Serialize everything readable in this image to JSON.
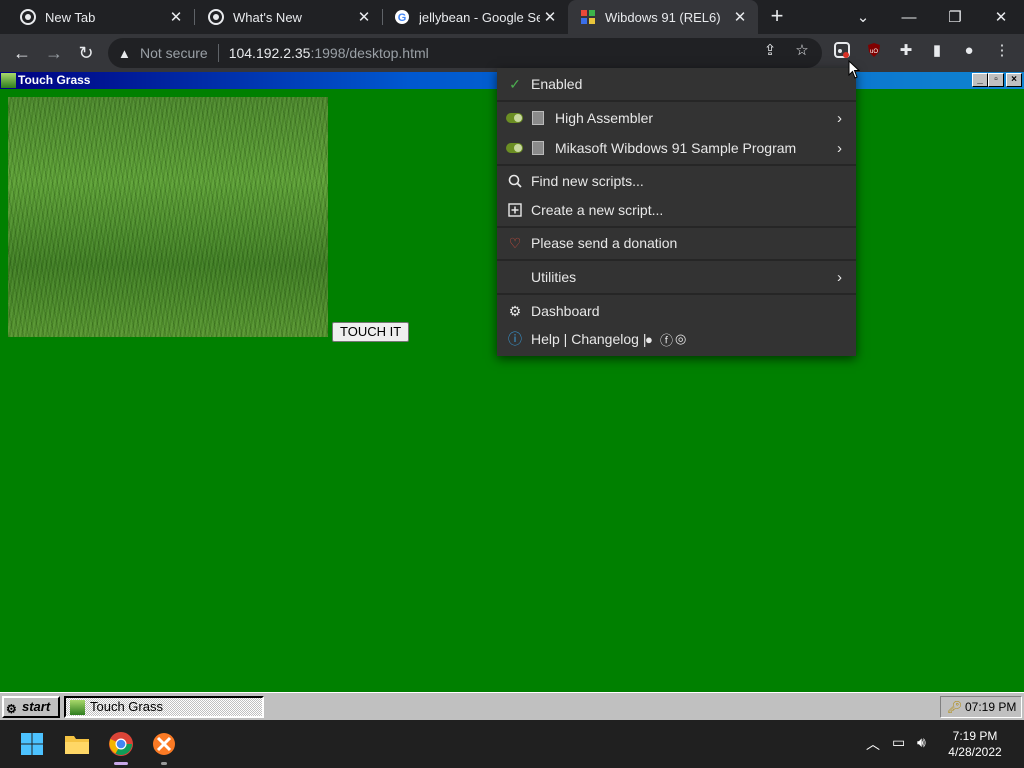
{
  "browser": {
    "tabs": [
      {
        "title": "New Tab",
        "favicon": "chrome-icon",
        "active": false
      },
      {
        "title": "What's New",
        "favicon": "chrome-icon",
        "active": false
      },
      {
        "title": "jellybean - Google Sear",
        "favicon": "google-icon",
        "active": false
      },
      {
        "title": "Wibdows 91 (REL6)",
        "favicon": "wibdows-icon",
        "active": true
      }
    ],
    "address": {
      "security": "Not secure",
      "host": "104.192.2.35",
      "path": ":1998/desktop.html"
    }
  },
  "window": {
    "title": "Touch Grass",
    "button_label": "TOUCH IT"
  },
  "menu": {
    "enabled": "Enabled",
    "scripts": [
      "High Assembler",
      "Mikasoft Wibdows 91 Sample Program"
    ],
    "find": "Find new scripts...",
    "create": "Create a new script...",
    "donate": "Please send a donation",
    "utilities": "Utilities",
    "dashboard": "Dashboard",
    "help": "Help | Changelog |"
  },
  "win91_taskbar": {
    "start": "start",
    "task": "Touch Grass",
    "clock": "07:19 PM"
  },
  "os_taskbar": {
    "time": "7:19 PM",
    "date": "4/28/2022"
  },
  "colors": {
    "desktop": "#008000",
    "titlebar": "#000080",
    "menu_bg": "#333333",
    "toggle": "#6b8e23",
    "heart": "#e05040",
    "info": "#3aa0e0"
  }
}
